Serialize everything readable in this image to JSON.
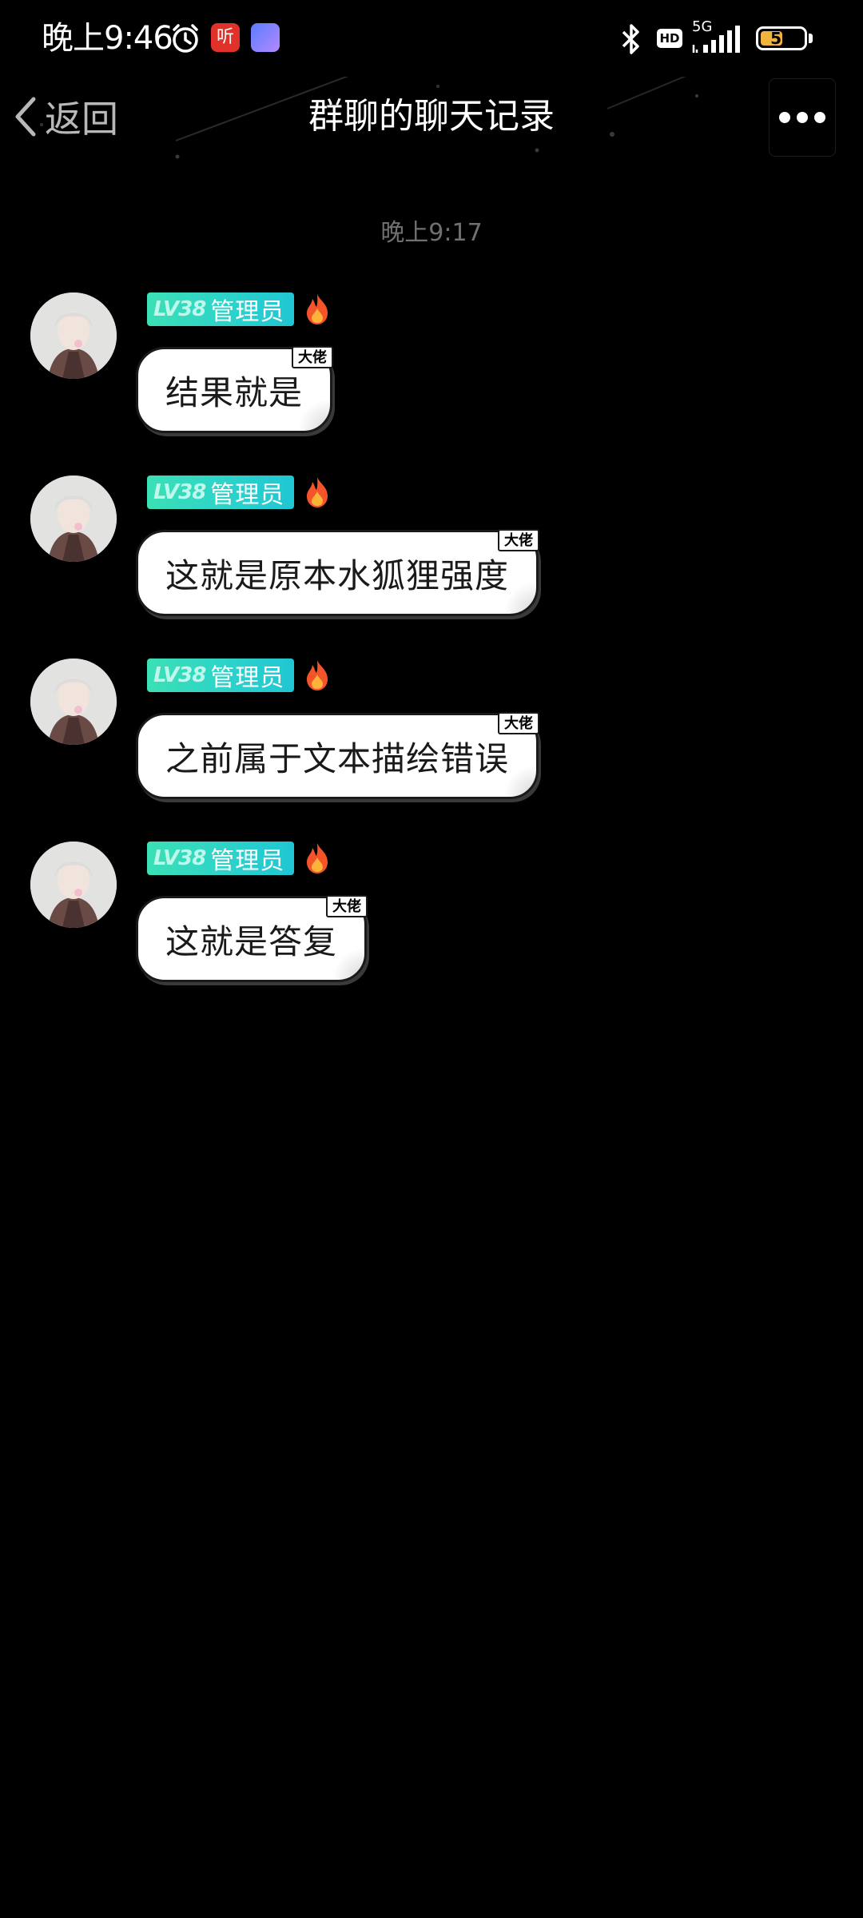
{
  "status_bar": {
    "time": "晚上9:46",
    "app1_icon_text": "听",
    "network": "5G",
    "hd_label": "HD",
    "battery_level": 52,
    "battery_text": "52"
  },
  "nav": {
    "back_label": "返回",
    "title": "群聊的聊天记录"
  },
  "chat": {
    "timestamp": "晚上9:17",
    "messages": [
      {
        "level": "LV38",
        "role": "管理员",
        "tag": "大佬",
        "text": "结果就是"
      },
      {
        "level": "LV38",
        "role": "管理员",
        "tag": "大佬",
        "text": "这就是原本水狐狸强度"
      },
      {
        "level": "LV38",
        "role": "管理员",
        "tag": "大佬",
        "text": "之前属于文本描绘错误"
      },
      {
        "level": "LV38",
        "role": "管理员",
        "tag": "大佬",
        "text": "这就是答复"
      }
    ]
  },
  "colors": {
    "background": "#000000",
    "badge_start": "#3be0b5",
    "badge_end": "#1fc6d4",
    "bubble": "#ffffff",
    "timestamp": "#707070"
  },
  "icons": [
    "alarm-icon",
    "bluetooth-icon",
    "signal-icon",
    "battery-icon",
    "chevron-left-icon",
    "more-icon",
    "fire-icon"
  ]
}
